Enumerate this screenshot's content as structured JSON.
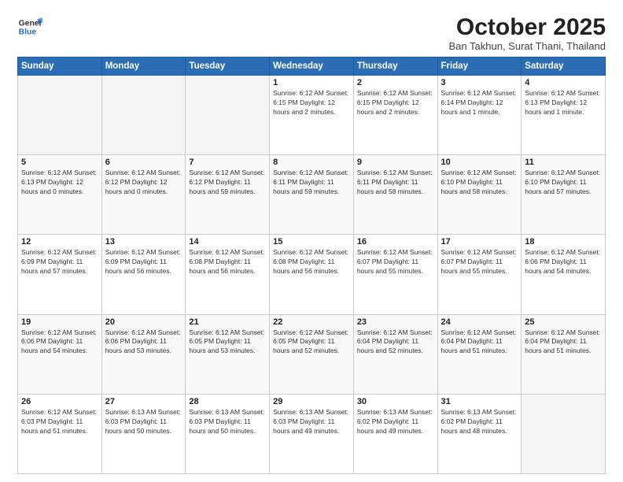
{
  "header": {
    "logo": {
      "line1": "General",
      "line2": "Blue"
    },
    "title": "October 2025",
    "subtitle": "Ban Takhun, Surat Thani, Thailand"
  },
  "weekdays": [
    "Sunday",
    "Monday",
    "Tuesday",
    "Wednesday",
    "Thursday",
    "Friday",
    "Saturday"
  ],
  "weeks": [
    [
      {
        "day": "",
        "info": ""
      },
      {
        "day": "",
        "info": ""
      },
      {
        "day": "",
        "info": ""
      },
      {
        "day": "1",
        "info": "Sunrise: 6:12 AM\nSunset: 6:15 PM\nDaylight: 12 hours\nand 2 minutes."
      },
      {
        "day": "2",
        "info": "Sunrise: 6:12 AM\nSunset: 6:15 PM\nDaylight: 12 hours\nand 2 minutes."
      },
      {
        "day": "3",
        "info": "Sunrise: 6:12 AM\nSunset: 6:14 PM\nDaylight: 12 hours\nand 1 minute."
      },
      {
        "day": "4",
        "info": "Sunrise: 6:12 AM\nSunset: 6:13 PM\nDaylight: 12 hours\nand 1 minute."
      }
    ],
    [
      {
        "day": "5",
        "info": "Sunrise: 6:12 AM\nSunset: 6:13 PM\nDaylight: 12 hours\nand 0 minutes."
      },
      {
        "day": "6",
        "info": "Sunrise: 6:12 AM\nSunset: 6:12 PM\nDaylight: 12 hours\nand 0 minutes."
      },
      {
        "day": "7",
        "info": "Sunrise: 6:12 AM\nSunset: 6:12 PM\nDaylight: 11 hours\nand 59 minutes."
      },
      {
        "day": "8",
        "info": "Sunrise: 6:12 AM\nSunset: 6:11 PM\nDaylight: 11 hours\nand 59 minutes."
      },
      {
        "day": "9",
        "info": "Sunrise: 6:12 AM\nSunset: 6:11 PM\nDaylight: 11 hours\nand 58 minutes."
      },
      {
        "day": "10",
        "info": "Sunrise: 6:12 AM\nSunset: 6:10 PM\nDaylight: 11 hours\nand 58 minutes."
      },
      {
        "day": "11",
        "info": "Sunrise: 6:12 AM\nSunset: 6:10 PM\nDaylight: 11 hours\nand 57 minutes."
      }
    ],
    [
      {
        "day": "12",
        "info": "Sunrise: 6:12 AM\nSunset: 6:09 PM\nDaylight: 11 hours\nand 57 minutes."
      },
      {
        "day": "13",
        "info": "Sunrise: 6:12 AM\nSunset: 6:09 PM\nDaylight: 11 hours\nand 56 minutes."
      },
      {
        "day": "14",
        "info": "Sunrise: 6:12 AM\nSunset: 6:08 PM\nDaylight: 11 hours\nand 56 minutes."
      },
      {
        "day": "15",
        "info": "Sunrise: 6:12 AM\nSunset: 6:08 PM\nDaylight: 11 hours\nand 56 minutes."
      },
      {
        "day": "16",
        "info": "Sunrise: 6:12 AM\nSunset: 6:07 PM\nDaylight: 11 hours\nand 55 minutes."
      },
      {
        "day": "17",
        "info": "Sunrise: 6:12 AM\nSunset: 6:07 PM\nDaylight: 11 hours\nand 55 minutes."
      },
      {
        "day": "18",
        "info": "Sunrise: 6:12 AM\nSunset: 6:06 PM\nDaylight: 11 hours\nand 54 minutes."
      }
    ],
    [
      {
        "day": "19",
        "info": "Sunrise: 6:12 AM\nSunset: 6:06 PM\nDaylight: 11 hours\nand 54 minutes."
      },
      {
        "day": "20",
        "info": "Sunrise: 6:12 AM\nSunset: 6:06 PM\nDaylight: 11 hours\nand 53 minutes."
      },
      {
        "day": "21",
        "info": "Sunrise: 6:12 AM\nSunset: 6:05 PM\nDaylight: 11 hours\nand 53 minutes."
      },
      {
        "day": "22",
        "info": "Sunrise: 6:12 AM\nSunset: 6:05 PM\nDaylight: 11 hours\nand 52 minutes."
      },
      {
        "day": "23",
        "info": "Sunrise: 6:12 AM\nSunset: 6:04 PM\nDaylight: 11 hours\nand 52 minutes."
      },
      {
        "day": "24",
        "info": "Sunrise: 6:12 AM\nSunset: 6:04 PM\nDaylight: 11 hours\nand 51 minutes."
      },
      {
        "day": "25",
        "info": "Sunrise: 6:12 AM\nSunset: 6:04 PM\nDaylight: 11 hours\nand 51 minutes."
      }
    ],
    [
      {
        "day": "26",
        "info": "Sunrise: 6:12 AM\nSunset: 6:03 PM\nDaylight: 11 hours\nand 51 minutes."
      },
      {
        "day": "27",
        "info": "Sunrise: 6:13 AM\nSunset: 6:03 PM\nDaylight: 11 hours\nand 50 minutes."
      },
      {
        "day": "28",
        "info": "Sunrise: 6:13 AM\nSunset: 6:03 PM\nDaylight: 11 hours\nand 50 minutes."
      },
      {
        "day": "29",
        "info": "Sunrise: 6:13 AM\nSunset: 6:03 PM\nDaylight: 11 hours\nand 49 minutes."
      },
      {
        "day": "30",
        "info": "Sunrise: 6:13 AM\nSunset: 6:02 PM\nDaylight: 11 hours\nand 49 minutes."
      },
      {
        "day": "31",
        "info": "Sunrise: 6:13 AM\nSunset: 6:02 PM\nDaylight: 11 hours\nand 48 minutes."
      },
      {
        "day": "",
        "info": ""
      }
    ]
  ]
}
